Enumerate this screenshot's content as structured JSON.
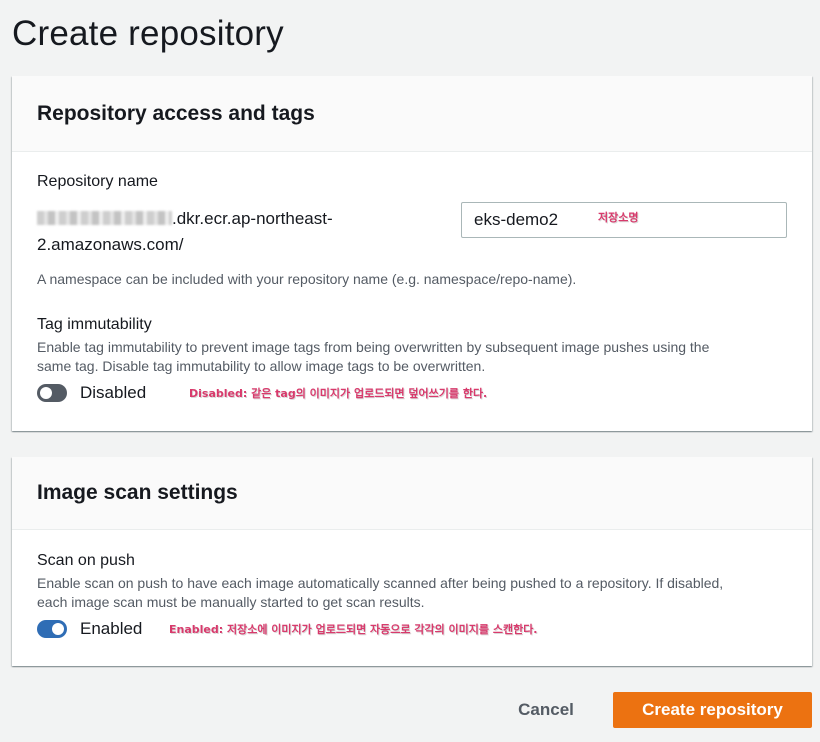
{
  "page": {
    "title": "Create repository"
  },
  "access_panel": {
    "title": "Repository access and tags",
    "repo_name_label": "Repository name",
    "registry_suffix_line1": ".dkr.ecr.ap-northeast-",
    "registry_suffix_line2": "2.amazonaws.com/",
    "repo_name_value": "eks-demo2",
    "repo_name_annotation": "저장소명",
    "namespace_hint": "A namespace can be included with your repository name (e.g. namespace/repo-name).",
    "tag_immutability_label": "Tag immutability",
    "tag_immutability_desc_line1": "Enable tag immutability to prevent image tags from being overwritten by subsequent image pushes using the",
    "tag_immutability_desc_line2": "same tag. Disable tag immutability to allow image tags to be overwritten.",
    "tag_immutability_state": "Disabled",
    "tag_immutability_enabled": false,
    "tag_immutability_annotation": "Disabled: 같은 tag의 이미지가 업로드되면 덮어쓰기를 한다."
  },
  "scan_panel": {
    "title": "Image scan settings",
    "scan_on_push_label": "Scan on push",
    "scan_on_push_desc_line1": "Enable scan on push to have each image automatically scanned after being pushed to a repository. If disabled,",
    "scan_on_push_desc_line2": "each image scan must be manually started to get scan results.",
    "scan_on_push_state": "Enabled",
    "scan_on_push_enabled": true,
    "scan_on_push_annotation": "Enabled: 저장소에 이미지가 업로드되면 자동으로 각각의 이미지를 스캔한다."
  },
  "actions": {
    "cancel_label": "Cancel",
    "create_label": "Create repository"
  },
  "colors": {
    "primary_button": "#ec7211",
    "toggle_on": "#2f6db5",
    "toggle_off": "#545b64",
    "annotation": "#d83a6c",
    "background": "#f2f3f3"
  }
}
